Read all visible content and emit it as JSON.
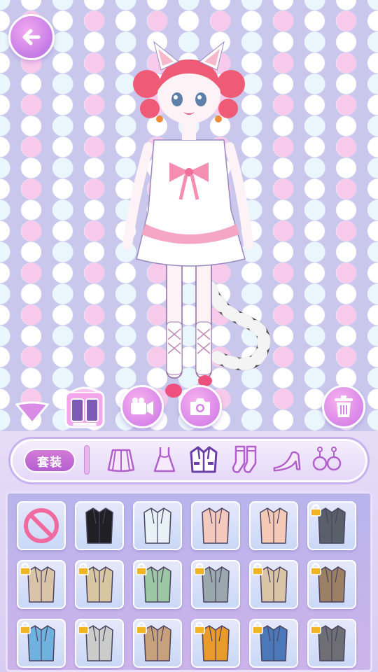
{
  "screen": "dress-up",
  "top_bar": {
    "back_icon": "arrow-left-icon"
  },
  "actions": {
    "collapse_icon": "triangle-down-icon",
    "wardrobe_icon": "wardrobe-icon",
    "video_icon": "video-camera-icon",
    "camera_icon": "camera-icon",
    "trash_icon": "trash-icon"
  },
  "category_bar": {
    "set_label": "套装",
    "categories": [
      {
        "name": "skirt",
        "icon": "skirt-icon"
      },
      {
        "name": "dress",
        "icon": "dress-icon"
      },
      {
        "name": "coat",
        "icon": "coat-icon",
        "selected": true
      },
      {
        "name": "socks",
        "icon": "socks-icon"
      },
      {
        "name": "heels",
        "icon": "high-heel-icon"
      },
      {
        "name": "earrings",
        "icon": "earrings-icon"
      }
    ]
  },
  "items": [
    {
      "kind": "none",
      "color": "#f06aa0",
      "locked": false
    },
    {
      "kind": "coat",
      "color": "#1f1f24",
      "locked": false
    },
    {
      "kind": "coat",
      "color": "#e8f2f6",
      "locked": false
    },
    {
      "kind": "coat",
      "color": "#f3c9bd",
      "locked": false
    },
    {
      "kind": "coat",
      "color": "#f4c9b6",
      "locked": false
    },
    {
      "kind": "coat",
      "color": "#59606a",
      "locked": true
    },
    {
      "kind": "coat",
      "color": "#d9c4a8",
      "locked": true
    },
    {
      "kind": "coat",
      "color": "#d8c6a1",
      "locked": true
    },
    {
      "kind": "coat",
      "color": "#9cc7a3",
      "locked": true
    },
    {
      "kind": "coat",
      "color": "#9aa8ae",
      "locked": true
    },
    {
      "kind": "coat",
      "color": "#d9c4a6",
      "locked": true
    },
    {
      "kind": "coat",
      "color": "#9b8066",
      "locked": true
    },
    {
      "kind": "coat",
      "color": "#6fb1df",
      "locked": true
    },
    {
      "kind": "coat",
      "color": "#c9ccc9",
      "locked": true
    },
    {
      "kind": "coat",
      "color": "#c7a07c",
      "locked": true
    },
    {
      "kind": "coat",
      "color": "#e89a2a",
      "locked": true
    },
    {
      "kind": "coat",
      "color": "#4b78b8",
      "locked": true
    },
    {
      "kind": "coat",
      "color": "#6d6f75",
      "locked": true
    }
  ],
  "colors": {
    "accent": "#c47ce6",
    "set_tab": "#b35fcf",
    "lock": "#f0b524"
  }
}
